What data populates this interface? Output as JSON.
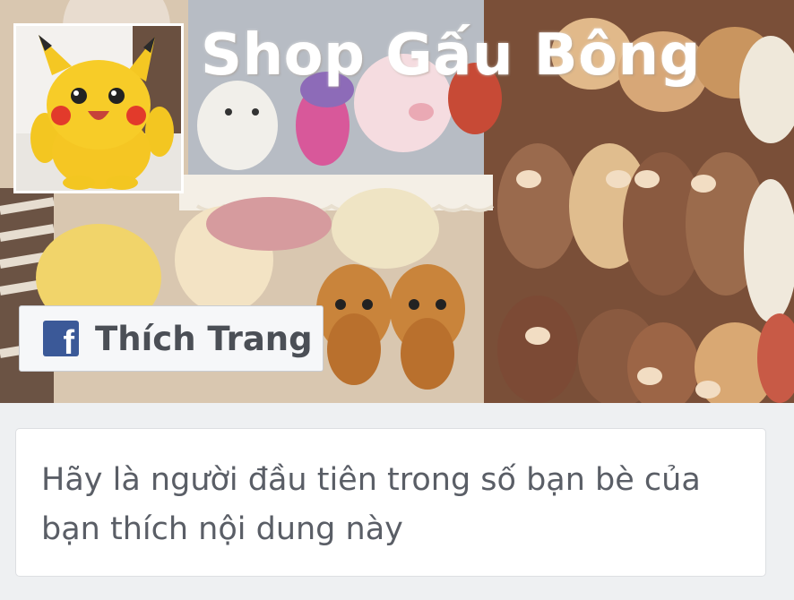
{
  "page": {
    "name": "Shop Gấu Bông",
    "cover_description_icon": "plush-toys-cover-photo",
    "profile_icon": "pikachu-plush-icon"
  },
  "like_button": {
    "label": "Thích Trang",
    "icon": "facebook-icon",
    "icon_color": "#3b5998"
  },
  "friends_card": {
    "message": "Hãy là người đầu tiên trong số bạn bè của bạn thích nội dung này"
  }
}
